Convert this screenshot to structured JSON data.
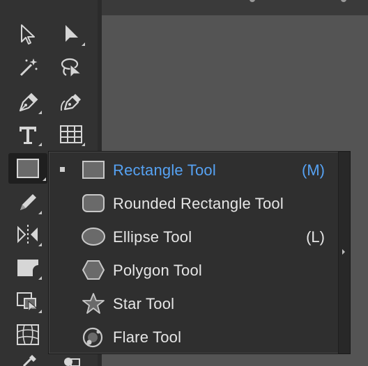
{
  "flyout": {
    "items": [
      {
        "label": "Rectangle Tool",
        "shortcut": "(M)",
        "selected": true
      },
      {
        "label": "Rounded Rectangle Tool",
        "shortcut": ""
      },
      {
        "label": "Ellipse Tool",
        "shortcut": "(L)"
      },
      {
        "label": "Polygon Tool",
        "shortcut": ""
      },
      {
        "label": "Star Tool",
        "shortcut": ""
      },
      {
        "label": "Flare Tool",
        "shortcut": ""
      }
    ]
  },
  "toolbar": {
    "tools": [
      "selection-icon",
      "direct-selection-icon",
      "magic-wand-icon",
      "lasso-icon",
      "pen-icon",
      "curvature-icon",
      "type-icon",
      "grid-icon",
      "rectangle-icon",
      "pencil-icon",
      "reflect-icon",
      "eraser-icon",
      "free-transform-icon",
      "mesh-icon"
    ]
  },
  "colors": {
    "selected_text": "#56a2f3",
    "menu_bg": "#2f2f2f",
    "toolbar_bg": "#323232"
  }
}
